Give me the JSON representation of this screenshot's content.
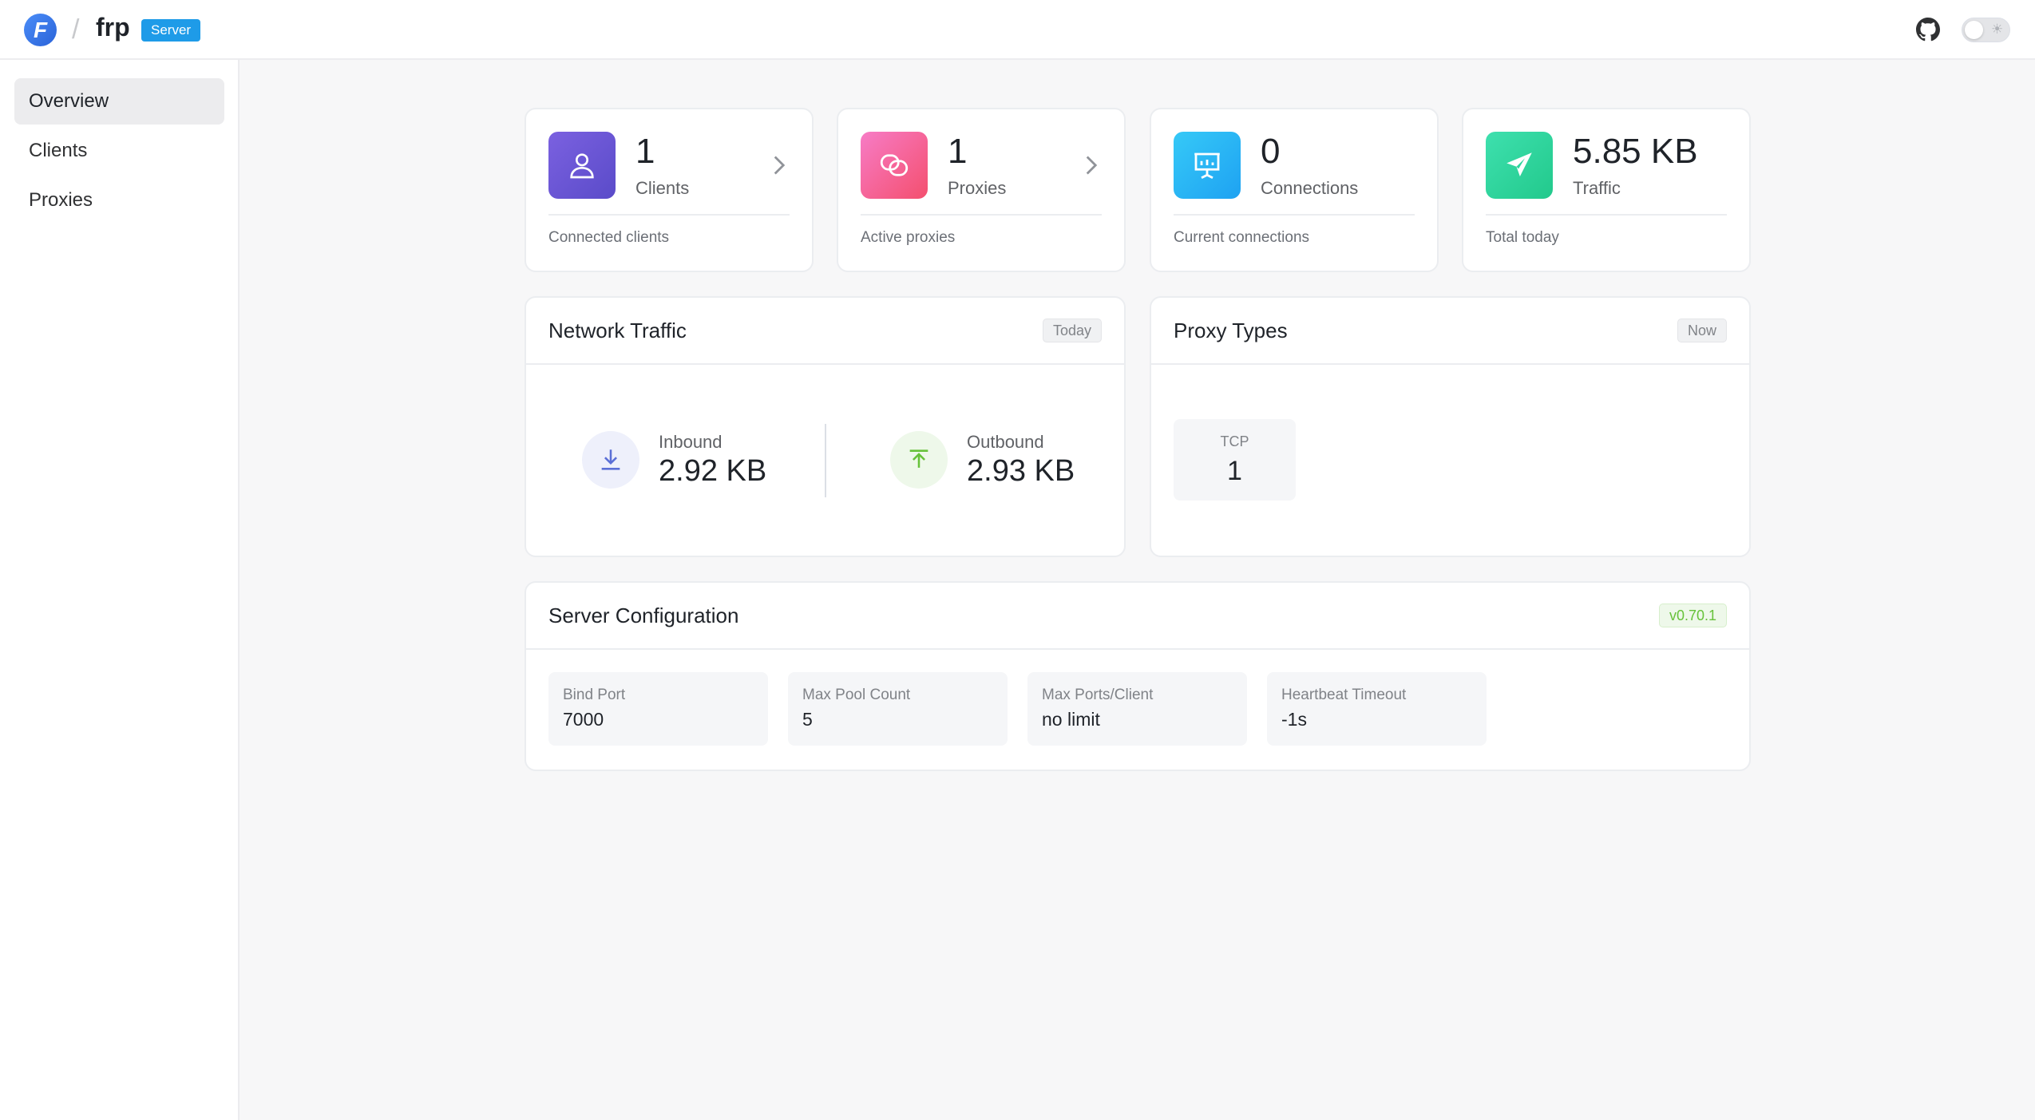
{
  "header": {
    "logo_letter": "F",
    "separator": "/",
    "app_name": "frp",
    "badge": "Server"
  },
  "sidebar": {
    "items": [
      {
        "label": "Overview",
        "active": true
      },
      {
        "label": "Clients",
        "active": false
      },
      {
        "label": "Proxies",
        "active": false
      }
    ]
  },
  "stats": [
    {
      "value": "1",
      "label": "Clients",
      "sub": "Connected clients",
      "icon": "user-icon",
      "color": "#6a5cd6",
      "clickable": true
    },
    {
      "value": "1",
      "label": "Proxies",
      "sub": "Active proxies",
      "icon": "link-icon",
      "color": "#f5527c",
      "clickable": true
    },
    {
      "value": "0",
      "label": "Connections",
      "sub": "Current connections",
      "icon": "presentation-chart-icon",
      "color": "#2bb8f5",
      "clickable": false
    },
    {
      "value": "5.85 KB",
      "label": "Traffic",
      "sub": "Total today",
      "icon": "paper-plane-icon",
      "color": "#2fd69a",
      "clickable": false
    }
  ],
  "network": {
    "title": "Network Traffic",
    "tag": "Today",
    "inbound_label": "Inbound",
    "inbound_value": "2.92 KB",
    "outbound_label": "Outbound",
    "outbound_value": "2.93 KB"
  },
  "proxy_types": {
    "title": "Proxy Types",
    "tag": "Now",
    "items": [
      {
        "label": "TCP",
        "value": "1"
      }
    ]
  },
  "server_config": {
    "title": "Server Configuration",
    "version": "v0.70.1",
    "items": [
      {
        "label": "Bind Port",
        "value": "7000"
      },
      {
        "label": "Max Pool Count",
        "value": "5"
      },
      {
        "label": "Max Ports/Client",
        "value": "no limit"
      },
      {
        "label": "Heartbeat Timeout",
        "value": "-1s"
      }
    ]
  },
  "colors": {
    "brand": "#1e9be8",
    "inbound": "#5b6fd6",
    "outbound": "#67c23a",
    "version_tag": "#67c23a"
  }
}
